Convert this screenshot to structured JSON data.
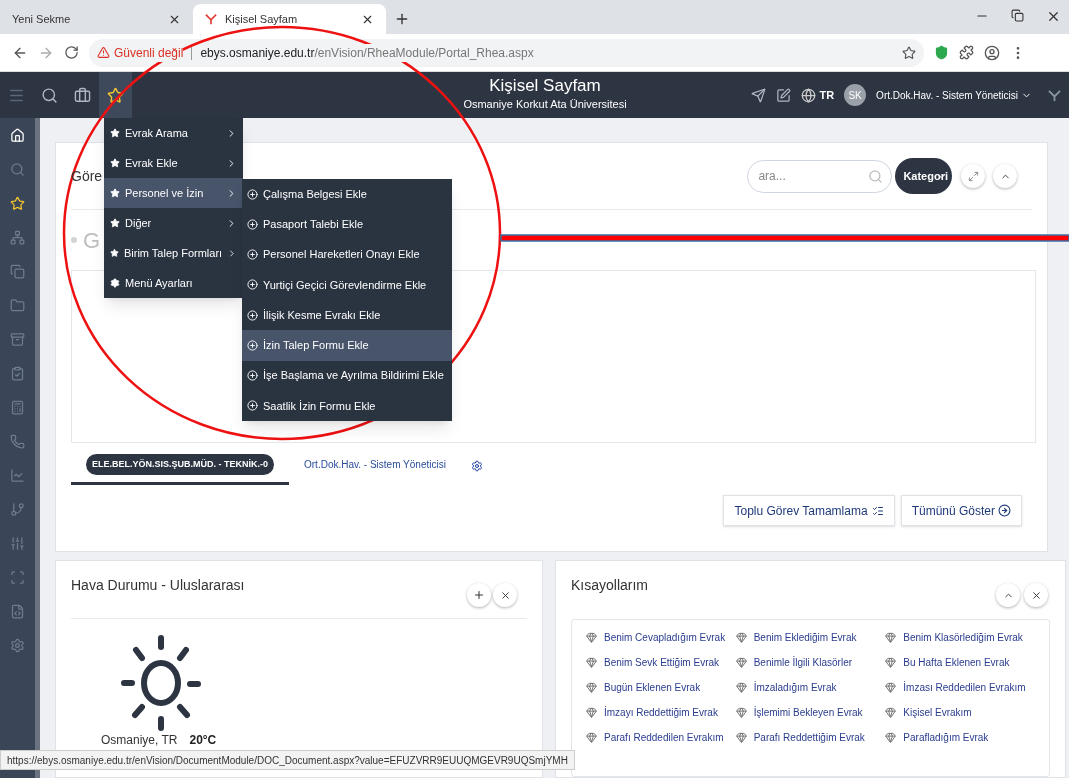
{
  "browser": {
    "tabs": [
      {
        "title": "Yeni Sekme",
        "selected": false
      },
      {
        "title": "Kişisel Sayfam",
        "selected": true
      }
    ],
    "security_label": "Güvenli değil",
    "url_host": "ebys.osmaniye.edu.tr",
    "url_path": "/enVision/RheaModule/Portal_Rhea.aspx"
  },
  "header": {
    "tools": [
      {
        "kind": "menu",
        "selected": false
      },
      {
        "kind": "search",
        "selected": false
      },
      {
        "kind": "briefcase",
        "selected": false
      },
      {
        "kind": "star",
        "selected": true
      }
    ],
    "title": "Kişisel Sayfam",
    "subtitle": "Osmaniye Korkut Ata Üniversitesi",
    "language": "TR",
    "avatar": "SK",
    "user": "Ort.Dok.Hav. - Sistem Yöneticisi"
  },
  "sidebar": [
    {
      "kind": "home",
      "selected": false
    },
    {
      "kind": "search",
      "selected": false
    },
    {
      "kind": "star",
      "selected": true
    },
    {
      "kind": "sitemap",
      "selected": false
    },
    {
      "kind": "copy",
      "selected": false
    },
    {
      "kind": "folder",
      "selected": false
    },
    {
      "kind": "archive",
      "selected": false
    },
    {
      "kind": "clipboard",
      "selected": false
    },
    {
      "kind": "calculator",
      "selected": false
    },
    {
      "kind": "phone",
      "selected": false
    },
    {
      "kind": "chart",
      "selected": false
    },
    {
      "kind": "branch",
      "selected": false
    },
    {
      "kind": "sliders",
      "selected": false
    },
    {
      "kind": "scan",
      "selected": false
    },
    {
      "kind": "code",
      "selected": false
    },
    {
      "kind": "settings",
      "selected": false
    }
  ],
  "tasks_panel": {
    "title": "Göre",
    "faded_text": "G",
    "search_placeholder": "ara...",
    "category_button": "Kategori",
    "tabs": [
      {
        "label": "ELE.BEL.YÖN.SIS.ŞUB.MÜD. - TEKNİK.-0",
        "selected": true
      },
      {
        "label": "Ort.Dok.Hav. - Sistem Yöneticisi",
        "selected": false
      }
    ],
    "buttons": [
      "Toplu Görev Tamamlama",
      "Tümünü Göster"
    ]
  },
  "weather_panel": {
    "title": "Hava Durumu - Uluslararası",
    "location": "Osmaniye, TR",
    "temperature": "20°C"
  },
  "shortcuts_panel": {
    "title": "Kısayollarım",
    "links": [
      "Benim Cevapladığım Evrak",
      "Benim Eklediğim Evrak",
      "Benim Klasörlediğim Evrak",
      "Benim Sevk Ettiğim Evrak",
      "Benimle İlgili Klasörler",
      "Bu Hafta Eklenen Evrak",
      "Bugün Eklenen Evrak",
      "İmzaladığım Evrak",
      "İmzası Reddedilen Evrakım",
      "İmzayı Reddettiğim Evrak",
      "İşlemimi Bekleyen Evrak",
      "Kişisel Evrakım",
      "Parafı Reddedilen Evrakım",
      "Parafı Reddettiğim Evrak",
      "Parafladığım Evrak"
    ]
  },
  "menu": {
    "items": [
      {
        "label": "Evrak Arama",
        "kind": "star",
        "submenu": true,
        "selected": false
      },
      {
        "label": "Evrak Ekle",
        "kind": "star",
        "submenu": true,
        "selected": false
      },
      {
        "label": "Personel ve İzin",
        "kind": "star",
        "submenu": true,
        "selected": true
      },
      {
        "label": "Diğer",
        "kind": "star",
        "submenu": true,
        "selected": false
      },
      {
        "label": "Birim Talep Formları",
        "kind": "star",
        "submenu": true,
        "selected": false
      },
      {
        "label": "Menü Ayarları",
        "kind": "settings",
        "submenu": false,
        "selected": false
      }
    ],
    "submenu": [
      {
        "label": "Çalışma Belgesi Ekle",
        "selected": false
      },
      {
        "label": "Pasaport Talebi Ekle",
        "selected": false
      },
      {
        "label": "Personel Hareketleri Onayı Ekle",
        "selected": false
      },
      {
        "label": "Yurtiçi Geçici Görevlendirme Ekle",
        "selected": false
      },
      {
        "label": "İlişik Kesme Evrakı Ekle",
        "selected": false
      },
      {
        "label": "İzin Talep Formu Ekle",
        "selected": true
      },
      {
        "label": "İşe Başlama ve Ayrılma Bildirimi Ekle",
        "selected": false
      },
      {
        "label": "Saatlik İzin Formu Ekle",
        "selected": false
      }
    ]
  },
  "status_url": "https://ebys.osmaniye.edu.tr/enVision/DocumentModule/DOC_Document.aspx?value=EFUZVRR9EUUQMGEVR9UQSmjYMH"
}
